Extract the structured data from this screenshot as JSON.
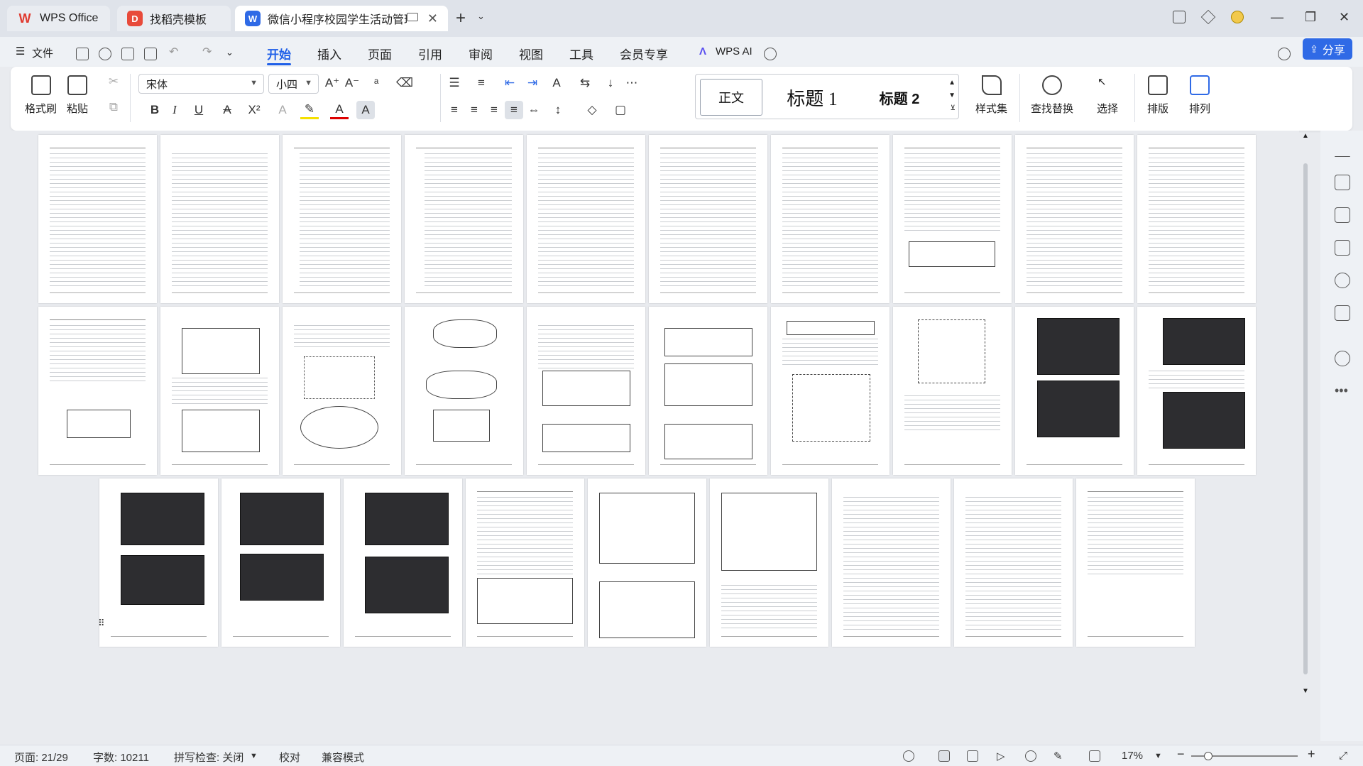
{
  "tabs": [
    {
      "label": "WPS Office",
      "icon": "wps-logo-icon",
      "color": "#e03a2f"
    },
    {
      "label": "找稻壳模板",
      "icon": "docer-icon",
      "color": "#e84a3a"
    },
    {
      "label": "微信小程序校园学生活动管理",
      "icon": "writer-doc-icon",
      "color": "#2f6ae6"
    }
  ],
  "menu": {
    "file": "文件",
    "items": [
      "开始",
      "插入",
      "页面",
      "引用",
      "审阅",
      "视图",
      "工具",
      "会员专享"
    ],
    "active": "开始",
    "wps_ai": "WPS AI",
    "share": "分享"
  },
  "ribbon": {
    "format_painter": "格式刷",
    "paste": "粘贴",
    "font_name": "宋体",
    "font_size": "小四",
    "styles": [
      "正文",
      "标题 1",
      "标题 2"
    ],
    "style_set": "样式集",
    "find_replace": "查找替换",
    "select": "选择",
    "layout": "排版",
    "arrange": "排列"
  },
  "status": {
    "page": "页面: 21/29",
    "words": "字数: 10211",
    "spellcheck": "拼写检查: 关闭",
    "proof": "校对",
    "compat": "兼容模式",
    "zoom": "17%"
  },
  "accent": "#2060e8",
  "share_color": "#2f6ae6"
}
